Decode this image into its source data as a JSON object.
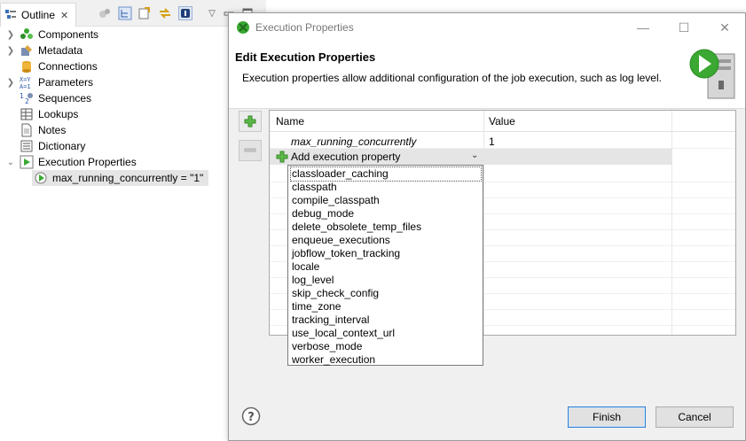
{
  "outline": {
    "tab_label": "Outline",
    "tree": [
      {
        "label": "Components",
        "icon": "components-icon",
        "expandable": true
      },
      {
        "label": "Metadata",
        "icon": "metadata-icon",
        "expandable": true
      },
      {
        "label": "Connections",
        "icon": "connections-icon",
        "expandable": false
      },
      {
        "label": "Parameters",
        "icon": "parameters-icon",
        "expandable": true
      },
      {
        "label": "Sequences",
        "icon": "sequences-icon",
        "expandable": false
      },
      {
        "label": "Lookups",
        "icon": "lookups-icon",
        "expandable": false
      },
      {
        "label": "Notes",
        "icon": "notes-icon",
        "expandable": false
      },
      {
        "label": "Dictionary",
        "icon": "dictionary-icon",
        "expandable": false
      },
      {
        "label": "Execution Properties",
        "icon": "execution-properties-icon",
        "expanded": true
      }
    ],
    "child_item": "max_running_concurrently = \"1\""
  },
  "dialog": {
    "window_title": "Execution Properties",
    "header_title": "Edit Execution Properties",
    "header_description": "Execution properties allow additional configuration of the job execution, such as log level.",
    "table": {
      "columns": [
        "Name",
        "Value"
      ],
      "rows": [
        {
          "name": "max_running_concurrently",
          "value": "1"
        }
      ],
      "add_row_label": "Add execution property"
    },
    "dropdown_options": [
      "classloader_caching",
      "classpath",
      "compile_classpath",
      "debug_mode",
      "delete_obsolete_temp_files",
      "enqueue_executions",
      "jobflow_token_tracking",
      "locale",
      "log_level",
      "skip_check_config",
      "time_zone",
      "tracking_interval",
      "use_local_context_url",
      "verbose_mode",
      "worker_execution"
    ],
    "buttons": {
      "finish": "Finish",
      "cancel": "Cancel"
    }
  },
  "colors": {
    "accent_green": "#3aa832",
    "selection_bg": "#e5e5e5",
    "default_button_border": "#2f7fd6"
  }
}
